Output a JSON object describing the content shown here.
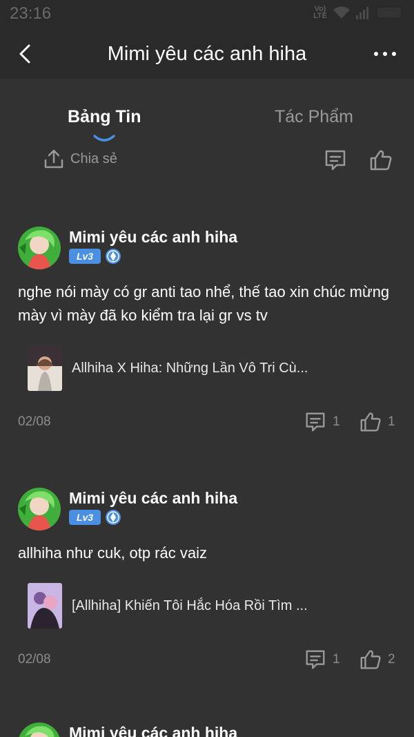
{
  "status": {
    "time": "23:16",
    "network": "LTE",
    "volte": "Vo)"
  },
  "nav": {
    "title": "Mimi yêu các anh hiha"
  },
  "tabs": [
    {
      "label": "Bảng Tin",
      "active": true
    },
    {
      "label": "Tác Phẩm",
      "active": false
    }
  ],
  "actions": {
    "share_label": "Chia sẻ"
  },
  "posts": [
    {
      "author": "Mimi yêu các anh hiha",
      "level": "Lv3",
      "content": "nghe nói mày có gr anti tao nhể, thế tao xin chúc mừng mày vì mày đã ko kiểm tra lại gr vs tv",
      "work_title": "Allhiha X Hiha: Những Lần Vô Tri Cù...",
      "date": "02/08",
      "comments": "1",
      "likes": "1"
    },
    {
      "author": "Mimi yêu các anh hiha",
      "level": "Lv3",
      "content": "allhiha như cuk, otp rác vaiz",
      "work_title": "[Allhiha] Khiến Tôi Hắc Hóa Rồi Tìm ...",
      "date": "02/08",
      "comments": "1",
      "likes": "2"
    },
    {
      "author": "Mimi yêu các anh hiha"
    }
  ],
  "colors": {
    "accent": "#4a90e2",
    "background": "#323232",
    "bar": "#2a2a2a"
  },
  "icons": [
    "back-arrow-icon",
    "more-icon",
    "share-icon",
    "comment-icon",
    "like-icon",
    "vip-badge-icon",
    "wifi-icon",
    "signal-icon"
  ]
}
